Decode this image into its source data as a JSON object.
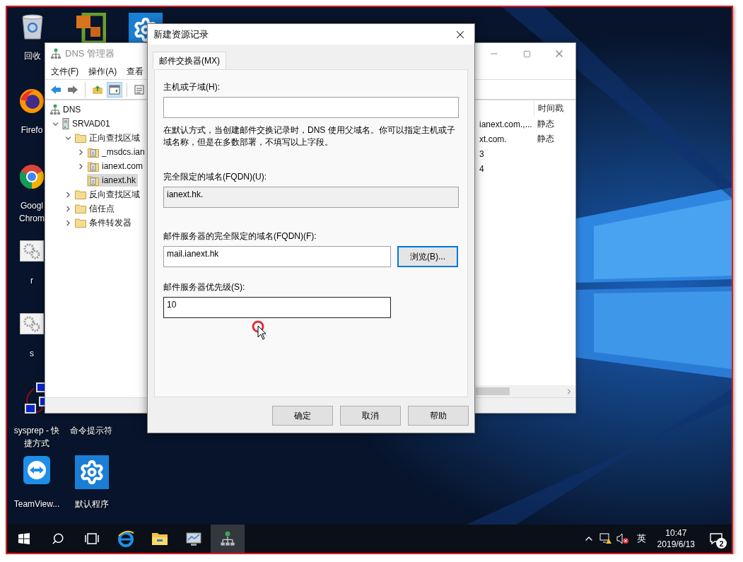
{
  "desktop_icons": [
    {
      "kind": "recycle-bin",
      "label": "回收"
    },
    {
      "kind": "app-tile"
    },
    {
      "kind": "gear-tile"
    },
    {
      "kind": "firefox",
      "label": "Firefo"
    },
    {
      "kind": "chrome",
      "label": "Googl Chrom"
    },
    {
      "kind": "gears-file",
      "label": "r"
    },
    {
      "kind": "gears-file",
      "label": "s"
    },
    {
      "kind": "network",
      "label": "sysprep - 快捷方式"
    },
    {
      "kind": "hidden",
      "label": "命令提示符"
    },
    {
      "kind": "teamviewer",
      "label": "TeamView..."
    },
    {
      "kind": "gear-tile",
      "label": "默认程序"
    }
  ],
  "dns_manager": {
    "title": "DNS 管理器",
    "menu": [
      "文件(F)",
      "操作(A)",
      "查看"
    ],
    "toolbar": [
      {
        "kind": "back",
        "selected": false
      },
      {
        "kind": "forward",
        "selected": false
      },
      {
        "kind": "folder-up",
        "selected": false
      },
      {
        "kind": "pane",
        "selected": true
      },
      {
        "kind": "properties",
        "selected": false
      }
    ],
    "tree": [
      {
        "kind": "dns-root",
        "label": "DNS",
        "selected": false,
        "children": [
          {
            "kind": "server",
            "label": "SRVAD01",
            "expanded": true,
            "selected": false,
            "children": [
              {
                "kind": "folder",
                "label": "正向查找区域",
                "expanded": true,
                "selected": false,
                "children": [
                  {
                    "kind": "zone",
                    "label": "_msdcs.ian",
                    "expanded": false,
                    "selected": false
                  },
                  {
                    "kind": "zone",
                    "label": "ianext.com",
                    "expanded": false,
                    "selected": false
                  },
                  {
                    "kind": "zone",
                    "label": "ianext.hk",
                    "selected": true
                  }
                ]
              },
              {
                "kind": "folder",
                "label": "反向查找区域",
                "expanded": false,
                "selected": false
              },
              {
                "kind": "folder",
                "label": "信任点",
                "expanded": false,
                "selected": false
              },
              {
                "kind": "folder",
                "label": "条件转发器",
                "expanded": false,
                "selected": false
              }
            ]
          }
        ]
      }
    ],
    "records": {
      "header": {
        "column_2": "时间戳"
      },
      "rows": [
        {
          "column_1": "ianext.com.,...",
          "column_2": "静态"
        },
        {
          "column_1": "xt.com.",
          "column_2": "静态"
        },
        {
          "column_1": "3"
        },
        {
          "column_1": "4"
        }
      ]
    }
  },
  "dialog": {
    "title": "新建资源记录",
    "tabs": [
      {
        "label": "邮件交换器(MX)",
        "selected": true
      }
    ],
    "host_field": {
      "label": "主机或子域(H):"
    },
    "description": "在默认方式，当创建邮件交换记录时，DNS 使用父域名。你可以指定主机或子域名称，但是在多数部署，不填写以上字段。",
    "fqdn_field": {
      "label": "完全限定的域名(FQDN)(U):",
      "value": "ianext.hk.",
      "readonly": true
    },
    "mail_server_field": {
      "label": "邮件服务器的完全限定的域名(FQDN)(F):",
      "value": "mail.ianext.hk",
      "focused": false
    },
    "browse_button": {
      "label": "浏览(B)...",
      "focused": true
    },
    "priority_field": {
      "label": "邮件服务器优先级(S):",
      "value": "10",
      "focused": true
    },
    "buttons": [
      "确定",
      "取消",
      "帮助"
    ]
  },
  "taskbar": {
    "items": [
      {
        "kind": "start",
        "selected": false
      },
      {
        "kind": "search",
        "selected": false
      },
      {
        "kind": "task-view",
        "selected": false
      },
      {
        "kind": "browser",
        "selected": false
      },
      {
        "kind": "file-explorer",
        "selected": false
      },
      {
        "kind": "monitor-app",
        "selected": false
      },
      {
        "kind": "dns",
        "selected": true
      }
    ],
    "tray": {
      "ime": "英",
      "time": "10:47",
      "date": "2019/6/13",
      "notifications": "2"
    }
  }
}
